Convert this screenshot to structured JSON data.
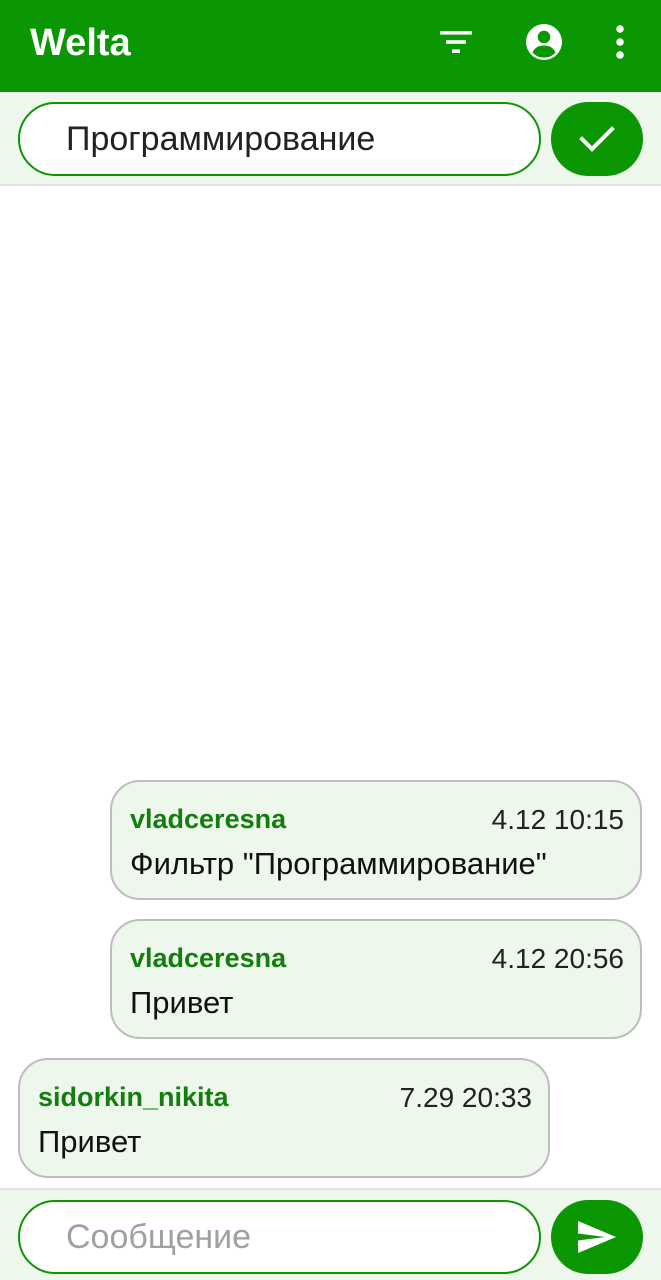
{
  "colors": {
    "primary": "#0b9603",
    "bubble_background": "#eef7ec",
    "author_color": "#137d0e"
  },
  "app_bar": {
    "title": "Welta",
    "icons": [
      "filter-icon",
      "account-circle-icon",
      "more-vert-icon"
    ]
  },
  "filter": {
    "value": "Программирование",
    "confirm_icon": "check-icon"
  },
  "messages": [
    {
      "author": "vladceresna",
      "time": "4.12 10:15",
      "text": "Фильтр \"Программирование\"",
      "align": "right"
    },
    {
      "author": "vladceresna",
      "time": "4.12 20:56",
      "text": "Привет",
      "align": "right"
    },
    {
      "author": "sidorkin_nikita",
      "time": "7.29 20:33",
      "text": "Привет",
      "align": "left"
    }
  ],
  "composer": {
    "placeholder": "Сообщение",
    "value": "",
    "send_icon": "send-icon"
  }
}
